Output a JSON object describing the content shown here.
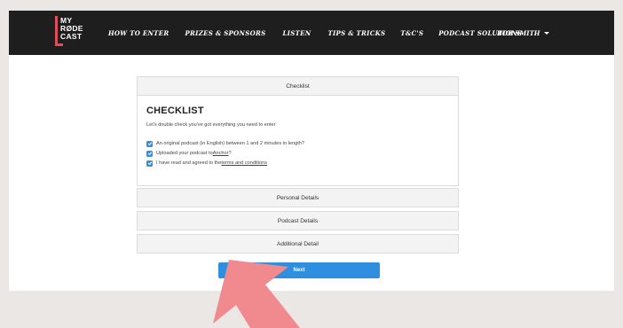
{
  "brand": {
    "logo_text": [
      "MY",
      "RØDE",
      "CAST"
    ],
    "accent_color": "#e0505a"
  },
  "nav": {
    "items": [
      {
        "label": "HOW TO ENTER"
      },
      {
        "label": "PRIZES & SPONSORS"
      },
      {
        "label": "LISTEN"
      },
      {
        "label": "TIPS & TRICKS"
      },
      {
        "label": "T&C'S"
      },
      {
        "label": "PODCAST SOLUTIONS"
      }
    ],
    "user": "BOB SMITH"
  },
  "checklist": {
    "header": "Checklist",
    "title": "CHECKLIST",
    "subtitle": "Let's double check you've got everything you need to enter",
    "items": [
      {
        "text": "An original podcast (in English) between 1 and 2 minutes in length?",
        "checked": true
      },
      {
        "text_before": "Uploaded your podcast to ",
        "link": "Anchor",
        "text_after": "?",
        "checked": true
      },
      {
        "text_before": "I have read and agreed to the ",
        "link": "terms and conditions",
        "text_after": "",
        "checked": true
      }
    ]
  },
  "sections": [
    {
      "label": "Personal Details"
    },
    {
      "label": "Podcast Details"
    },
    {
      "label": "Additional Detail"
    }
  ],
  "actions": {
    "next_label": "Next",
    "button_color": "#2e8ee0"
  },
  "annotation": {
    "arrow_color": "#f08a8e"
  }
}
